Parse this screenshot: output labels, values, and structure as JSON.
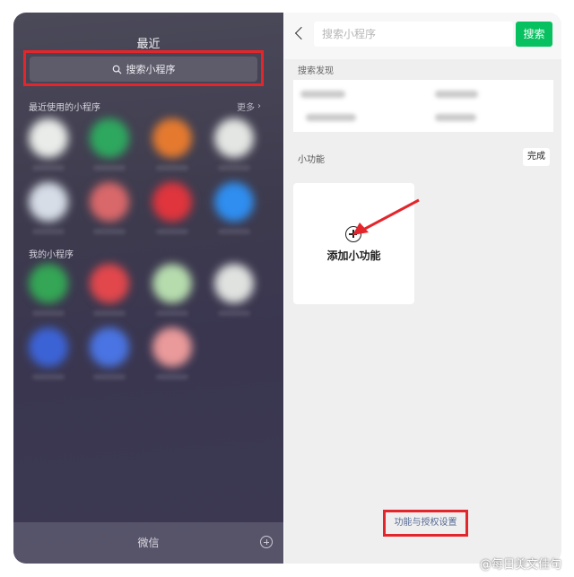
{
  "left_panel": {
    "title": "最近",
    "search_label": "搜索小程序",
    "recent_section": "最近使用的小程序",
    "more": "更多",
    "my_section": "我的小程序",
    "dock_label": "微信",
    "recent_apps": [
      "#e9ece9",
      "#2ea85f",
      "#e57a2f",
      "#e4e6e3",
      "#d6dde7",
      "#d9686a",
      "#e0353d",
      "#2f8ef0"
    ],
    "my_apps": [
      "#34a655",
      "#e2474c",
      "#b6dcae",
      "#dfe2df",
      "#3c63d6",
      "#4a74e3",
      "#ea9a9a"
    ]
  },
  "right_panel": {
    "search_placeholder": "搜索小程序",
    "search_button": "搜索",
    "discover_label": "搜索发现",
    "small_features_label": "小功能",
    "done_button": "完成",
    "add_feature_label": "添加小功能",
    "auth_settings_link": "功能与授权设置"
  },
  "colors": {
    "accent_green": "#07c160",
    "highlight_red": "#e3262b",
    "link_blue": "#576b95"
  },
  "watermark": "@每日美文佳句"
}
